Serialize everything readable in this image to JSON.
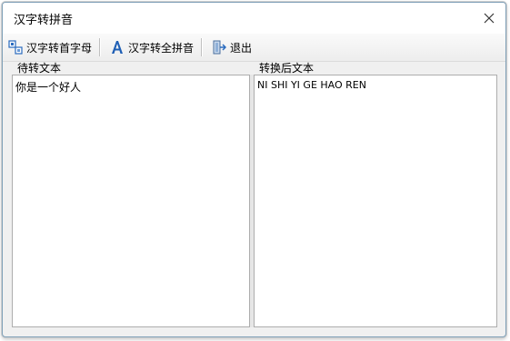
{
  "window": {
    "title": "汉字转拼音"
  },
  "toolbar": {
    "initials_label": "汉字转首字母",
    "full_pinyin_label": "汉字转全拼音",
    "exit_label": "退出"
  },
  "left_panel": {
    "label": "待转文本",
    "content": "你是一个好人"
  },
  "right_panel": {
    "label": "转换后文本",
    "content": "NI SHI YI GE HAO REN"
  },
  "icons": {
    "close": "close-icon",
    "initials": "initials-icon",
    "full_pinyin": "font-a-icon",
    "exit": "exit-door-icon"
  },
  "colors": {
    "window_border": "#7fa0b8",
    "icon_blue": "#2a6bbf",
    "toolbar_bg": "#ededed"
  }
}
